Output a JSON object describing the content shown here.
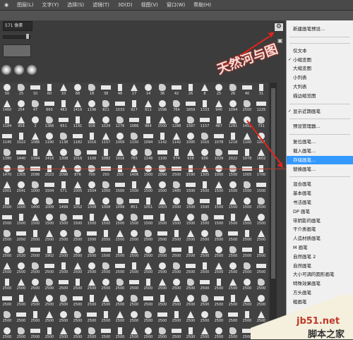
{
  "menubar": {
    "items": [
      "◉",
      "图层(L)",
      "文字(Y)",
      "选择(S)",
      "滤镜(T)",
      "3D(D)",
      "视图(V)",
      "窗口(W)",
      "帮助(H)"
    ]
  },
  "panel": {
    "size_value": "571 像素"
  },
  "grid_rows": [
    [
      "50",
      "25",
      "10",
      "60",
      "10",
      "68",
      "18",
      "38",
      "48",
      "17",
      "14",
      "36",
      "42",
      "26",
      "8",
      "25",
      "26",
      "40",
      "31"
    ],
    [
      "1460",
      "254",
      "47",
      "660",
      "463",
      "1416",
      "1196",
      "821",
      "1033",
      "927",
      "611",
      "1596",
      "764",
      "1659",
      "1333",
      "946",
      "1094",
      "2500",
      "1225"
    ],
    [
      "1184",
      "958",
      "3",
      "1366",
      "651",
      "1191",
      "936",
      "1029",
      "1276",
      "1066",
      "964",
      "2500",
      "1288",
      "1587",
      "1157",
      "487",
      "1281",
      "1451",
      "731"
    ],
    [
      "1145",
      "1022",
      "1086",
      "1190",
      "1138",
      "1182",
      "1016",
      "1157",
      "1009",
      "1150",
      "1094",
      "1142",
      "1142",
      "1095",
      "1016",
      "1078",
      "1218",
      "1100",
      "1201"
    ],
    [
      "1380",
      "1440",
      "1394",
      "1416",
      "1308",
      "1016",
      "1106",
      "1082",
      "1016",
      "765",
      "1148",
      "1100",
      "574",
      "638",
      "936",
      "1029",
      "2022",
      "1078",
      "1602"
    ],
    [
      "1470",
      "1305",
      "2096",
      "2023",
      "2096",
      "876",
      "700",
      "250",
      "250",
      "1406",
      "1500",
      "2090",
      "2500",
      "1590",
      "1305",
      "1000",
      "1500",
      "1005",
      "1700"
    ],
    [
      "2001",
      "2041",
      "1000",
      "1504",
      "571",
      "1005",
      "1504",
      "1000",
      "1500",
      "1500",
      "1500",
      "1500",
      "1485",
      "1500",
      "1500",
      "1500",
      "1500",
      "1500",
      "1500"
    ],
    [
      "2500",
      "1000",
      "1400",
      "1009",
      "1499",
      "1052",
      "1008",
      "1008",
      "1099",
      "851",
      "1051",
      "1003",
      "1500",
      "1500",
      "1500",
      "1500",
      "1500",
      "1500",
      "2500"
    ],
    [
      "2500",
      "1500",
      "1500",
      "1500",
      "1500",
      "1500",
      "1500",
      "1500",
      "1500",
      "1500",
      "1500",
      "1500",
      "1500",
      "1500",
      "1500",
      "1500",
      "1500",
      "1500",
      "1500"
    ],
    [
      "2500",
      "2050",
      "2500",
      "2500",
      "2500",
      "2500",
      "1500",
      "2050",
      "2500",
      "2500",
      "2500",
      "2500",
      "2500",
      "2500",
      "2500",
      "2500",
      "2500",
      "2500",
      "2500"
    ],
    [
      "2500",
      "2020",
      "2500",
      "1902",
      "2500",
      "2500",
      "2500",
      "1500",
      "2500",
      "2500",
      "2500",
      "2500",
      "2500",
      "2500",
      "2500",
      "2500",
      "2500",
      "2500",
      "2500"
    ],
    [
      "2500",
      "2500",
      "2500",
      "2500",
      "2500",
      "2500",
      "2500",
      "2500",
      "2500",
      "2500",
      "2500",
      "2500",
      "2500",
      "2500",
      "2500",
      "2500",
      "2500",
      "2500",
      "2500"
    ],
    [
      "2500",
      "2500",
      "2500",
      "2500",
      "2500",
      "2500",
      "2500",
      "2500",
      "2500",
      "2500",
      "2500",
      "2500",
      "2500",
      "2500",
      "2500",
      "2500",
      "2500",
      "2500",
      "2500"
    ],
    [
      "2500",
      "2500",
      "2500",
      "2500",
      "2500",
      "2500",
      "2500",
      "2500",
      "2500",
      "2500",
      "2500",
      "2500",
      "2500",
      "2500",
      "2500",
      "2500",
      "2500",
      "2500",
      "2500"
    ],
    [
      "2500",
      "2500",
      "2500",
      "2500",
      "2500",
      "2500",
      "2500",
      "2500",
      "2500",
      "2500",
      "2500",
      "2500",
      "2500",
      "2500",
      "2500",
      "2500",
      "2500",
      "2500",
      "2500"
    ],
    [
      "2500",
      "2500",
      "2500",
      "2500",
      "2500",
      "2500",
      "2500",
      "2500",
      "2500",
      "2500",
      "2500",
      "2500",
      "2500",
      "2500",
      "2500",
      "2500",
      "2500",
      "2500",
      "2500"
    ]
  ],
  "menu": {
    "items": [
      {
        "label": "新建画笔预设...",
        "checked": false,
        "selected": false
      },
      {
        "label": "",
        "sep": true
      },
      {
        "label": "",
        "sep": true
      },
      {
        "label": "仅文本",
        "checked": false,
        "selected": false
      },
      {
        "label": "小缩览图",
        "checked": true,
        "selected": false
      },
      {
        "label": "大缩览图",
        "checked": false,
        "selected": false
      },
      {
        "label": "小列表",
        "checked": false,
        "selected": false
      },
      {
        "label": "大列表",
        "checked": false,
        "selected": false
      },
      {
        "label": "描边缩览图",
        "checked": false,
        "selected": false
      },
      {
        "label": "",
        "sep": true
      },
      {
        "label": "显示近期画笔",
        "checked": true,
        "selected": false
      },
      {
        "label": "",
        "sep": true
      },
      {
        "label": "预设管理器...",
        "checked": false,
        "selected": false
      },
      {
        "label": "",
        "sep": true
      },
      {
        "label": "复位画笔...",
        "checked": false,
        "selected": false
      },
      {
        "label": "载入画笔...",
        "checked": false,
        "selected": false
      },
      {
        "label": "存储画笔...",
        "checked": false,
        "selected": true
      },
      {
        "label": "替换画笔...",
        "checked": false,
        "selected": false
      },
      {
        "label": "",
        "sep": true
      },
      {
        "label": "混合画笔",
        "checked": false,
        "selected": false
      },
      {
        "label": "基本画笔",
        "checked": false,
        "selected": false
      },
      {
        "label": "书法画笔",
        "checked": false,
        "selected": false
      },
      {
        "label": "DP 画笔",
        "checked": false,
        "selected": false
      },
      {
        "label": "带阴影的画笔",
        "checked": false,
        "selected": false
      },
      {
        "label": "干介质画笔",
        "checked": false,
        "selected": false
      },
      {
        "label": "人造材质画笔",
        "checked": false,
        "selected": false
      },
      {
        "label": "M 画笔",
        "checked": false,
        "selected": false
      },
      {
        "label": "自然画笔 2",
        "checked": false,
        "selected": false
      },
      {
        "label": "自然画笔",
        "checked": false,
        "selected": false
      },
      {
        "label": "大小可调的圆形画笔",
        "checked": false,
        "selected": false
      },
      {
        "label": "特殊效果画笔",
        "checked": false,
        "selected": false
      },
      {
        "label": "方头画笔",
        "checked": false,
        "selected": false
      },
      {
        "label": "粗画笔",
        "checked": false,
        "selected": false
      }
    ]
  },
  "watermark": {
    "text": "天然河与图"
  },
  "site": {
    "line1": "jb51.net",
    "line2": "脚本之家"
  },
  "colors": {
    "accent_red": "#e0251b",
    "menu_selected": "#3399ff"
  }
}
